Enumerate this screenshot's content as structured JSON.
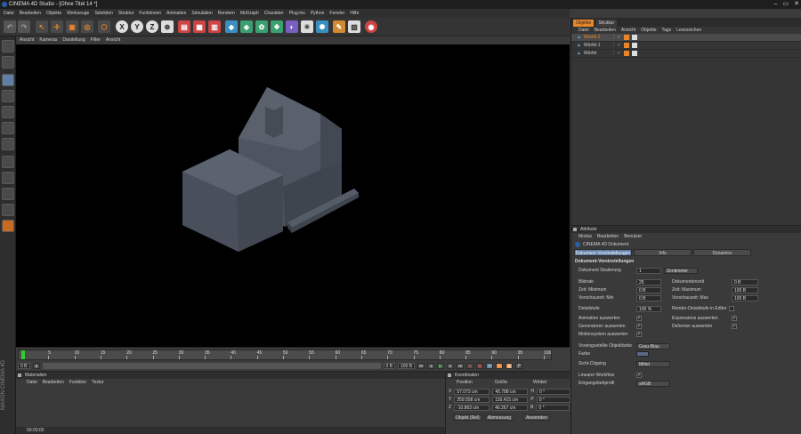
{
  "window": {
    "title": "CINEMA 4D Studio - [Ohne Titel 14 *]",
    "controls": [
      "–",
      "▭",
      "✕"
    ]
  },
  "menubar": [
    "Datei",
    "Bearbeiten",
    "Objekte",
    "Werkzeuge",
    "Selektion",
    "Struktur",
    "Funktionen",
    "Animation",
    "Simulation",
    "Rendern",
    "MoGraph",
    "Charakter",
    "Plug-ins",
    "Python",
    "Fenster",
    "Hilfe"
  ],
  "viewport": {
    "menu": [
      "Ansicht",
      "Kameras",
      "Darstellung",
      "Filter",
      "Ansicht"
    ]
  },
  "timeline": {
    "ticks": [
      "0",
      "5",
      "10",
      "15",
      "20",
      "25",
      "30",
      "35",
      "40",
      "45",
      "50",
      "55",
      "60",
      "65",
      "70",
      "75",
      "80",
      "85",
      "90",
      "95",
      "100"
    ],
    "current_frame": "0 B",
    "start_field": "0 B",
    "end_field": "100 B",
    "end_field2": "100 B",
    "frame_right": "0 B"
  },
  "materials": {
    "title": "Materialien",
    "menu": [
      "Datei",
      "Bearbeiten",
      "Funktion",
      "Textur"
    ]
  },
  "coords": {
    "title": "Koordinaten",
    "headers": [
      "Position",
      "Größe",
      "Winkel"
    ],
    "rows": [
      {
        "axis": "X",
        "pos": "57.073 cm",
        "size": "45.788 cm",
        "ang_label": "H",
        "ang": "0 °"
      },
      {
        "axis": "Y",
        "pos": "259.558 cm",
        "size": "116.415 cm",
        "ang_label": "P",
        "ang": "0 °"
      },
      {
        "axis": "Z",
        "pos": "-10.863 cm",
        "size": "46.267 cm",
        "ang_label": "B",
        "ang": "0 °"
      }
    ],
    "mode": "Objekt (Rel)",
    "size_mode": "Abmessung",
    "apply": "Anwenden"
  },
  "objects": {
    "tabs": [
      "Objekte",
      "Struktur"
    ],
    "menu": [
      "Datei",
      "Bearbeiten",
      "Ansicht",
      "Objekte",
      "Tags",
      "Lesezeichen"
    ],
    "items": [
      "Würfel.2",
      "Würfel.1",
      "Würfel"
    ]
  },
  "attributes": {
    "title": "Attribute",
    "menu": [
      "Modus",
      "Bearbeiten",
      "Benutzer"
    ],
    "doc_name": "CINEMA 4D Dokument",
    "tabs": [
      "Dokument-Voreinstellungen",
      "Info",
      "Dynamics"
    ],
    "section": "Dokument-Voreinstellungen",
    "scale_label": "Dokument Skalierung",
    "scale_value": "1",
    "scale_unit": "Zentimeter",
    "left_fields": [
      {
        "label": "Bildrate",
        "value": "25"
      },
      {
        "label": "Zeit: Minimum",
        "value": "0 B"
      },
      {
        "label": "Vorschauzeit: Min",
        "value": "0 B"
      }
    ],
    "right_fields": [
      {
        "label": "Dokumentenzeit",
        "value": "0 B"
      },
      {
        "label": "Zeit: Maximum",
        "value": "100 B"
      },
      {
        "label": "Vorschauzeit: Max",
        "value": "100 B"
      }
    ],
    "lod_label": "Detailstufe",
    "lod_value": "100 %",
    "render_lod_label": "Render-Detailstufe in Editor",
    "checks_left": [
      "Animation auswerten",
      "Generatoren auswerten",
      "Motionsystem auswerten"
    ],
    "checks_right": [
      "Expressions auswerten",
      "Deformer auswerten"
    ],
    "obj_color_label": "Voreingestellte Objektfarbe",
    "obj_color_value": "Grau-Blau",
    "color_label": "Farbe",
    "clip_label": "Sicht-Clipping",
    "clip_value": "Mittel",
    "linear_label": "Linearer Workflow",
    "profile_label": "Eingangsfarbprofil",
    "profile_value": "sRGB"
  },
  "status": {
    "time": "00:00:00"
  },
  "brand": "MAXON CINEMA 4D",
  "colors": {
    "accent": "#e8862a",
    "selected_tab": "#5f7fa6",
    "viewport_bg": "#000000",
    "house": "#4f5662"
  }
}
